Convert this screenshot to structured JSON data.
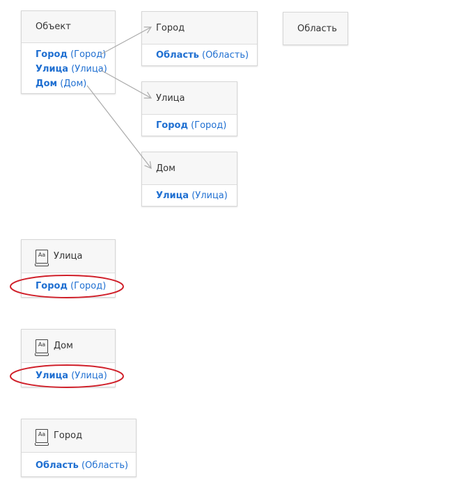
{
  "diagram": {
    "cards": [
      {
        "id": "object",
        "title": "Объект",
        "fields": [
          {
            "name": "Город",
            "type": "(Город)"
          },
          {
            "name": "Улица",
            "type": "(Улица)"
          },
          {
            "name": "Дом",
            "type": "(Дом)"
          }
        ]
      },
      {
        "id": "city",
        "title": "Город",
        "fields": [
          {
            "name": "Область",
            "type": "(Область)"
          }
        ]
      },
      {
        "id": "region",
        "title": "Область",
        "fields": []
      },
      {
        "id": "street",
        "title": "Улица",
        "fields": [
          {
            "name": "Город",
            "type": "(Город)"
          }
        ]
      },
      {
        "id": "house",
        "title": "Дом",
        "fields": [
          {
            "name": "Улица",
            "type": "(Улица)"
          }
        ]
      },
      {
        "id": "dict_street",
        "title": "Улица",
        "icon": "dictionary-icon",
        "fields": [
          {
            "name": "Город",
            "type": "(Город)"
          }
        ]
      },
      {
        "id": "dict_house",
        "title": "Дом",
        "icon": "dictionary-icon",
        "fields": [
          {
            "name": "Улица",
            "type": "(Улица)"
          }
        ]
      },
      {
        "id": "dict_city",
        "title": "Город",
        "icon": "dictionary-icon",
        "fields": [
          {
            "name": "Область",
            "type": "(Область)"
          }
        ]
      }
    ],
    "icon_text": "Aa",
    "colors": {
      "link": "#1f6fd1",
      "arrow": "#aaaaaa",
      "highlight": "#d0202a"
    }
  }
}
